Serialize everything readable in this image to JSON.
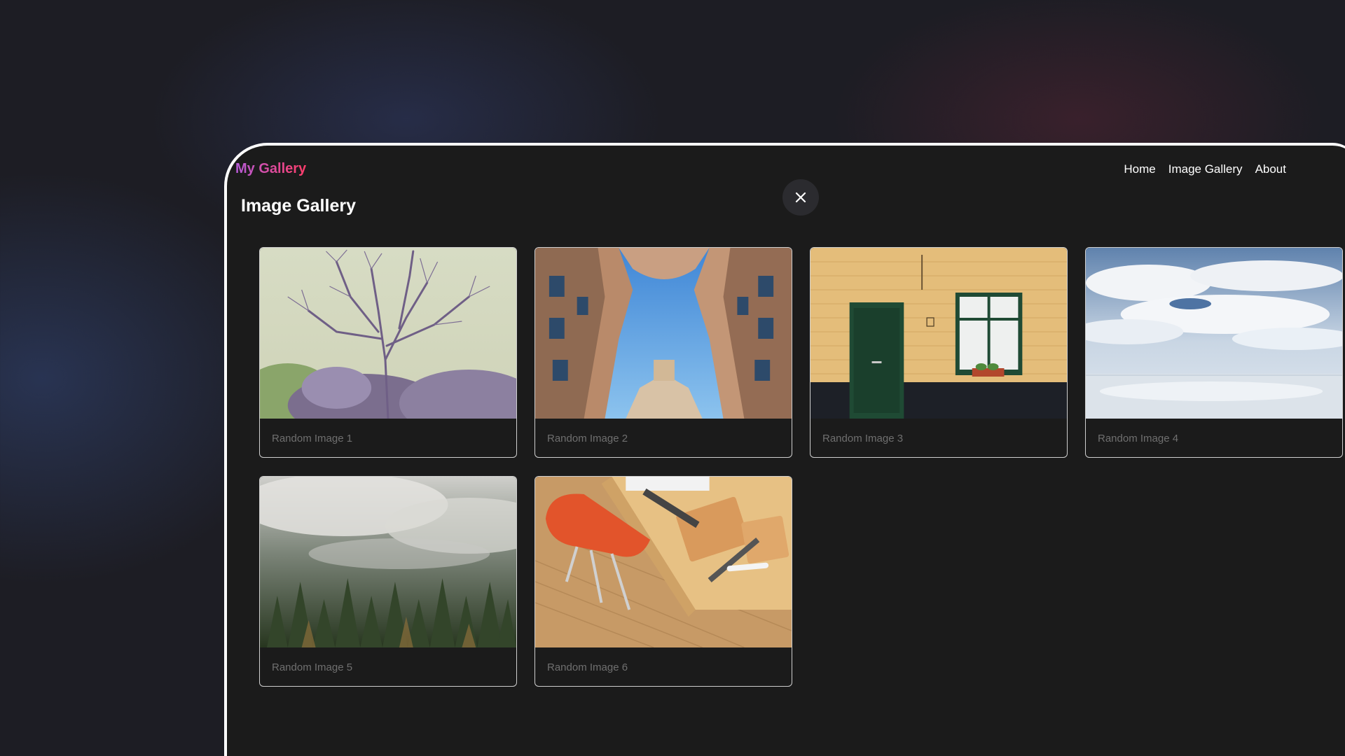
{
  "navbar": {
    "brand": "My Gallery",
    "links": [
      {
        "label": "Home"
      },
      {
        "label": "Image Gallery"
      },
      {
        "label": "About"
      }
    ]
  },
  "page_title": "Image Gallery",
  "close_button": {
    "icon": "close-icon"
  },
  "gallery": {
    "items": [
      {
        "caption": "Random Image 1",
        "subject": "bare tree against pale sky"
      },
      {
        "caption": "Random Image 2",
        "subject": "upward view between buildings"
      },
      {
        "caption": "Random Image 3",
        "subject": "yellow brick wall with green door"
      },
      {
        "caption": "Random Image 4",
        "subject": "clouds reflected on water"
      },
      {
        "caption": "Random Image 5",
        "subject": "misty pine forest"
      },
      {
        "caption": "Random Image 6",
        "subject": "wooden desk with orange chair"
      }
    ]
  },
  "colors": {
    "brand_gradient_start": "#b55bd6",
    "brand_gradient_end": "#ff3d6a",
    "panel_background": "#1b1b1b",
    "caption_text": "#6f6f6f",
    "card_border": "#cfcfcf"
  }
}
